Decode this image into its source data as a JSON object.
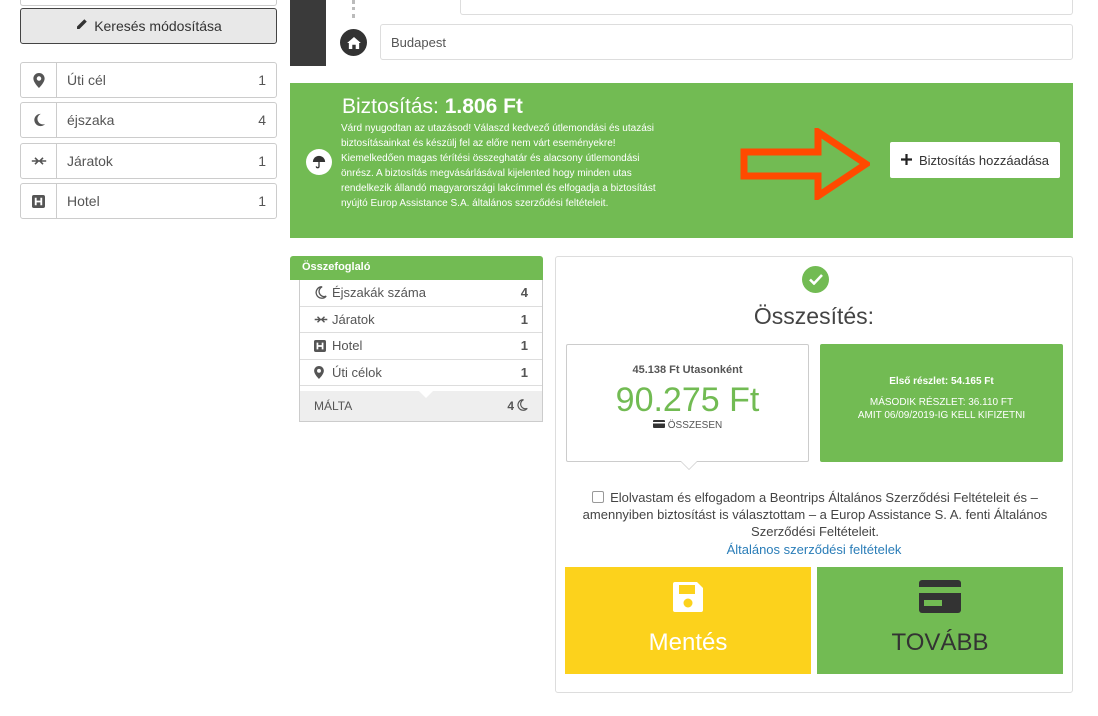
{
  "sidebar": {
    "search_button_label": "Keresés módosítása",
    "items": [
      {
        "icon": "map-pin-icon",
        "label": "Úti cél",
        "count": "1"
      },
      {
        "icon": "moon-icon",
        "label": "éjszaka",
        "count": "4"
      },
      {
        "icon": "plane-icon",
        "label": "Járatok",
        "count": "1"
      },
      {
        "icon": "hotel-icon",
        "label": "Hotel",
        "count": "1"
      }
    ]
  },
  "departure": {
    "icon": "home-icon",
    "value": "Budapest"
  },
  "insurance": {
    "title_prefix": "Biztosítás:",
    "title_amount": "1.806 Ft",
    "description": "Várd nyugodtan az utazásod! Válaszd kedvező útlemondási és utazási biztosításainkat és készülj fel az előre nem várt eseményekre! Kiemelkedően magas térítési összeghatár és alacsony útlemondási önrész. A biztosítás megvásárlásával kijelented hogy minden utas rendelkezik állandó magyarországi lakcímmel és elfogadja a biztosítást nyújtó Europ Assistance S.A. általános szerződési feltételeit.",
    "add_button_label": "Biztosítás hozzáadása",
    "arrow_color": "#ff4a00"
  },
  "summary": {
    "header": "Összefoglaló",
    "rows": [
      {
        "icon": "moon-icon",
        "label": "Éjszakák száma",
        "count": "4"
      },
      {
        "icon": "plane-icon",
        "label": "Járatok",
        "count": "1"
      },
      {
        "icon": "hotel-icon",
        "label": "Hotel",
        "count": "1"
      },
      {
        "icon": "map-pin-icon",
        "label": "Úti célok",
        "count": "1"
      }
    ],
    "destination": "MÁLTA",
    "destination_nights": "4"
  },
  "total": {
    "title": "Összesítés:",
    "per_person": "45.138 Ft Utasonként",
    "total_price": "90.275 Ft",
    "total_label": "ÖSSZESEN",
    "first_installment": "Első részlet: 54.165 Ft",
    "second_installment": "MÁSODIK RÉSZLET: 36.110 FT",
    "due_text": "AMIT 06/09/2019-IG KELL KIFIZETNI",
    "terms_text": "Elolvastam és elfogadom a Beontrips Általános Szerződési Feltételeit és – amennyiben biztosítást is választottam – a Europ Assistance S. A. fenti Általános Szerződési Feltételeit.",
    "terms_link": "Általános szerződési feltételek",
    "save_label": "Mentés",
    "next_label": "TOVÁBB"
  },
  "colors": {
    "accent_green": "#72bb53",
    "save_yellow": "#fcd21c",
    "link_blue": "#2a7db8",
    "dark": "#3a3a3a"
  }
}
